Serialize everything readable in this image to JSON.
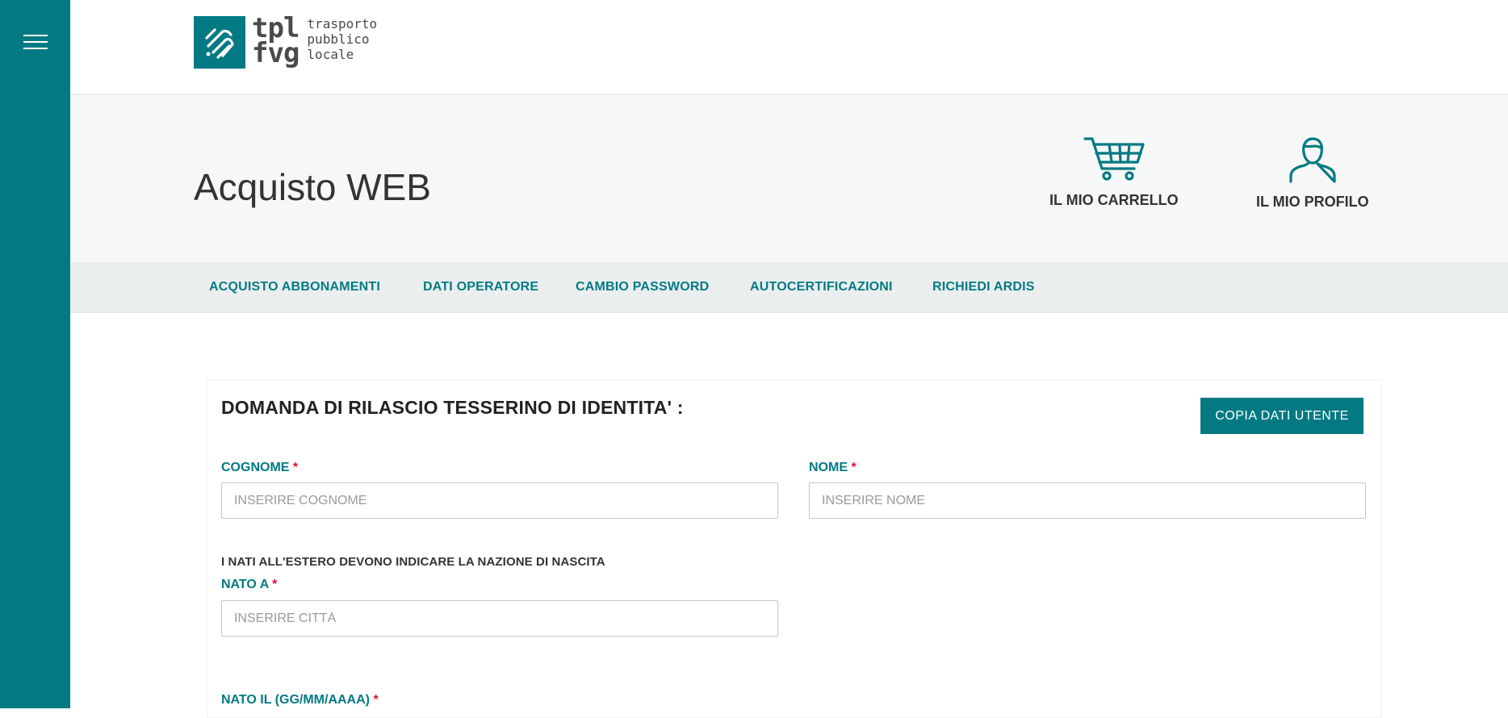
{
  "logo": {
    "brand_lines": [
      "tpl",
      "fvg"
    ],
    "tagline_lines": [
      "trasporto",
      "pubblico",
      "locale"
    ]
  },
  "header": {
    "title": "Acquisto WEB",
    "cart_label": "IL MIO CARRELLO",
    "profile_label": "IL MIO PROFILO"
  },
  "nav": {
    "items": [
      {
        "label": "ACQUISTO ABBONAMENTI"
      },
      {
        "label": "DATI OPERATORE"
      },
      {
        "label": "CAMBIO PASSWORD"
      },
      {
        "label": "AUTOCERTIFICAZIONI"
      },
      {
        "label": "RICHIEDI ARDIS"
      }
    ]
  },
  "form": {
    "title": "DOMANDA DI RILASCIO TESSERINO DI IDENTITA' :",
    "copy_button": "COPIA DATI UTENTE",
    "required_mark": "*",
    "cognome": {
      "label": "COGNOME",
      "placeholder": "INSERIRE COGNOME",
      "value": ""
    },
    "nome": {
      "label": "NOME",
      "placeholder": "INSERIRE NOME",
      "value": ""
    },
    "note": "I NATI ALL'ESTERO DEVONO INDICARE LA NAZIONE DI NASCITA",
    "nato_a": {
      "label": "NATO A",
      "placeholder": "INSERIRE CITTÀ",
      "value": ""
    },
    "nato_il": {
      "label": "NATO IL (GG/MM/AAAA)"
    }
  },
  "colors": {
    "accent": "#037a83",
    "required": "#d9143c"
  }
}
